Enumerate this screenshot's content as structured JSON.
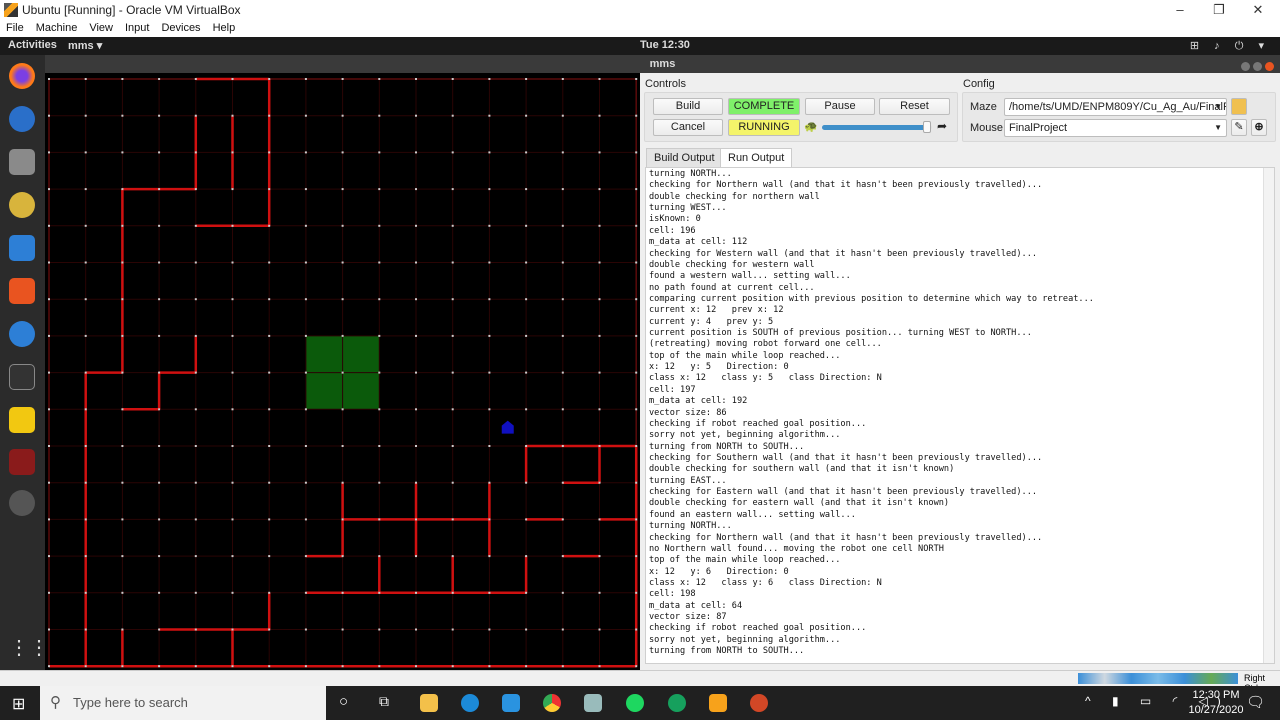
{
  "vbox": {
    "title": "Ubuntu [Running] - Oracle VM VirtualBox",
    "menu": [
      "File",
      "Machine",
      "View",
      "Input",
      "Devices",
      "Help"
    ],
    "host_key": "Right Ctrl"
  },
  "ubuntu_bar": {
    "activities": "Activities",
    "app": "mms ▾",
    "clock": "Tue 12:30",
    "tray": "⊞ ♪ ⏻ ▾"
  },
  "window": {
    "title": "mms"
  },
  "controls": {
    "title": "Controls",
    "build": "Build",
    "build_status": "COMPLETE",
    "pause": "Pause",
    "reset": "Reset",
    "cancel": "Cancel",
    "run_status": "RUNNING",
    "speed_fraction": 0.95,
    "colors": {
      "complete": "#7ff06a",
      "running": "#f4f46a"
    }
  },
  "config": {
    "title": "Config",
    "maze_label": "Maze",
    "maze_value": "/home/ts/UMD/ENPM809Y/Cu_Ag_Au/FinalPr",
    "mouse_label": "Mouse",
    "mouse_value": "FinalProject"
  },
  "tabs": [
    {
      "label": "Build Output",
      "active": false
    },
    {
      "label": "Run Output",
      "active": true
    }
  ],
  "run_output": [
    "turning NORTH...",
    "checking for Northern wall (and that it hasn't been previously travelled)...",
    "double checking for northern wall",
    "turning WEST...",
    "isKnown: 0",
    "cell: 196",
    "m_data at cell: 112",
    "checking for Western wall (and that it hasn't been previously travelled)...",
    "double checking for western wall",
    "found a western wall... setting wall...",
    "no path found at current cell...",
    "comparing current position with previous position to determine which way to retreat...",
    "current x: 12   prev x: 12",
    "current y: 4   prev y: 5",
    "current position is SOUTH of previous position... turning WEST to NORTH...",
    "(retreating) moving robot forward one cell...",
    "top of the main while loop reached...",
    "x: 12   y: 5   Direction: 0",
    "class x: 12   class y: 5   class Direction: N",
    "cell: 197",
    "m_data at cell: 192",
    "vector size: 86",
    "checking if robot reached goal position...",
    "sorry not yet, beginning algorithm...",
    "turning from NORTH to SOUTH...",
    "checking for Southern wall (and that it hasn't been previously travelled)...",
    "double checking for southern wall (and that it isn't known)",
    "turning EAST...",
    "checking for Eastern wall (and that it hasn't been previously travelled)...",
    "double checking for eastern wall (and that it isn't known)",
    "found an eastern wall... setting wall...",
    "turning NORTH...",
    "checking for Northern wall (and that it hasn't been previously travelled)...",
    "no Northern wall found... moving the robot one cell NORTH",
    "top of the main while loop reached...",
    "x: 12   y: 6   Direction: 0",
    "class x: 12   class y: 6   class Direction: N",
    "cell: 198",
    "m_data at cell: 64",
    "vector size: 87",
    "checking if robot reached goal position...",
    "sorry not yet, beginning algorithm...",
    "turning from NORTH to SOUTH..."
  ],
  "maze": {
    "size": 16,
    "wall_color": "#d01010",
    "goal_color": "#0b5a0b",
    "mouse_color": "#1010c0",
    "goal": {
      "x": [
        7,
        9
      ],
      "y": [
        7,
        9
      ]
    },
    "mouse": {
      "col": 12,
      "row": 9,
      "heading": "N"
    },
    "known_walls": [
      [
        4,
        0,
        6,
        0
      ],
      [
        6,
        0,
        6,
        4
      ],
      [
        4,
        1,
        4,
        3
      ],
      [
        5,
        1,
        5,
        3
      ],
      [
        2,
        3,
        4,
        3
      ],
      [
        2,
        3,
        2,
        8
      ],
      [
        4,
        4,
        6,
        4
      ],
      [
        1,
        8,
        2,
        8
      ],
      [
        1,
        8,
        1,
        16
      ],
      [
        4,
        7,
        4,
        8
      ],
      [
        3,
        8,
        4,
        8
      ],
      [
        3,
        8,
        3,
        9
      ],
      [
        2,
        9,
        3,
        9
      ],
      [
        13,
        10,
        16,
        10
      ],
      [
        13,
        10,
        13,
        11
      ],
      [
        15,
        10,
        15,
        11
      ],
      [
        14,
        11,
        15,
        11
      ],
      [
        16,
        10,
        16,
        16
      ],
      [
        8,
        11,
        8,
        13
      ],
      [
        8,
        12,
        12,
        12
      ],
      [
        10,
        11,
        10,
        13
      ],
      [
        12,
        11,
        12,
        13
      ],
      [
        7,
        13,
        8,
        13
      ],
      [
        13,
        12,
        14,
        12
      ],
      [
        15,
        12,
        16,
        12
      ],
      [
        14,
        13,
        15,
        13
      ],
      [
        9,
        13,
        9,
        14
      ],
      [
        11,
        13,
        11,
        14
      ],
      [
        13,
        13,
        13,
        14
      ],
      [
        7,
        14,
        13,
        14
      ],
      [
        6,
        14,
        6,
        15
      ],
      [
        3,
        15,
        6,
        15
      ],
      [
        5,
        15,
        5,
        16
      ],
      [
        2,
        15,
        2,
        16
      ],
      [
        0,
        16,
        16,
        16
      ]
    ]
  },
  "taskbar": {
    "search_placeholder": "Type here to search",
    "time": "12:30 PM",
    "date": "10/27/2020"
  }
}
